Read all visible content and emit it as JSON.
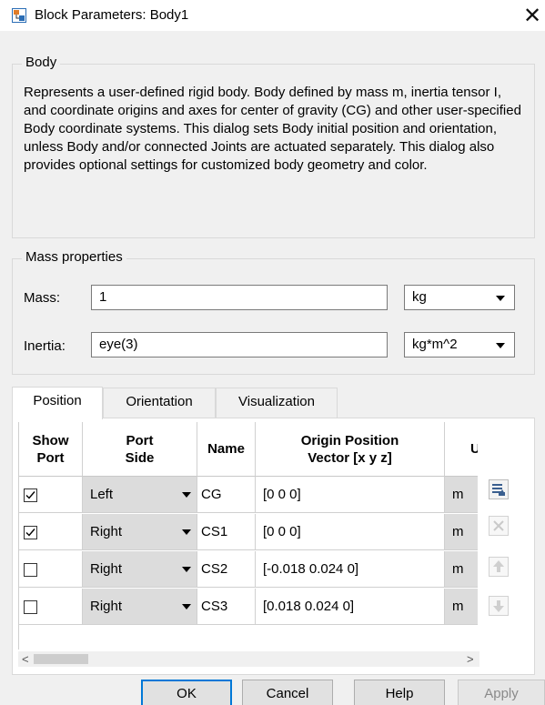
{
  "window": {
    "title": "Block Parameters: Body1",
    "close_glyph": "✕"
  },
  "body_group": {
    "legend": "Body",
    "description": "Represents a user-defined rigid body. Body defined by mass m, inertia tensor I, and coordinate origins and axes for center of gravity (CG) and other user-specified Body coordinate systems. This dialog sets Body initial position and orientation, unless Body and/or connected Joints are actuated separately. This dialog also provides optional settings for customized body geometry and color."
  },
  "mass_group": {
    "legend": "Mass properties",
    "mass_label": "Mass:",
    "mass_value": "1",
    "mass_unit": "kg",
    "inertia_label": "Inertia:",
    "inertia_value": "eye(3)",
    "inertia_unit": "kg*m^2"
  },
  "tabs": [
    {
      "label": "Position",
      "active": true
    },
    {
      "label": "Orientation",
      "active": false
    },
    {
      "label": "Visualization",
      "active": false
    }
  ],
  "table": {
    "headers": [
      "Show\nPort",
      "Port\nSide",
      "Name",
      "Origin Position\nVector [x y z]",
      "Un"
    ],
    "rows": [
      {
        "show_port": true,
        "port_side": "Left",
        "name": "CG",
        "origin": "[0 0 0]",
        "unit": "m"
      },
      {
        "show_port": true,
        "port_side": "Right",
        "name": "CS1",
        "origin": "[0 0 0]",
        "unit": "m"
      },
      {
        "show_port": false,
        "port_side": "Right",
        "name": "CS2",
        "origin": "[-0.018 0.024 0]",
        "unit": "m"
      },
      {
        "show_port": false,
        "port_side": "Right",
        "name": "CS3",
        "origin": "[0.018 0.024 0]",
        "unit": "m"
      }
    ]
  },
  "side_buttons": [
    "add-row-icon",
    "delete-row-icon",
    "move-up-icon",
    "move-down-icon"
  ],
  "scroll": {
    "left_glyph": "<",
    "right_glyph": ">"
  },
  "buttons": {
    "ok": "OK",
    "cancel": "Cancel",
    "help": "Help",
    "apply": "Apply"
  },
  "colors": {
    "accent": "#0078d7",
    "cell_gray": "#dcdcdc",
    "background": "#f0f0f0"
  }
}
